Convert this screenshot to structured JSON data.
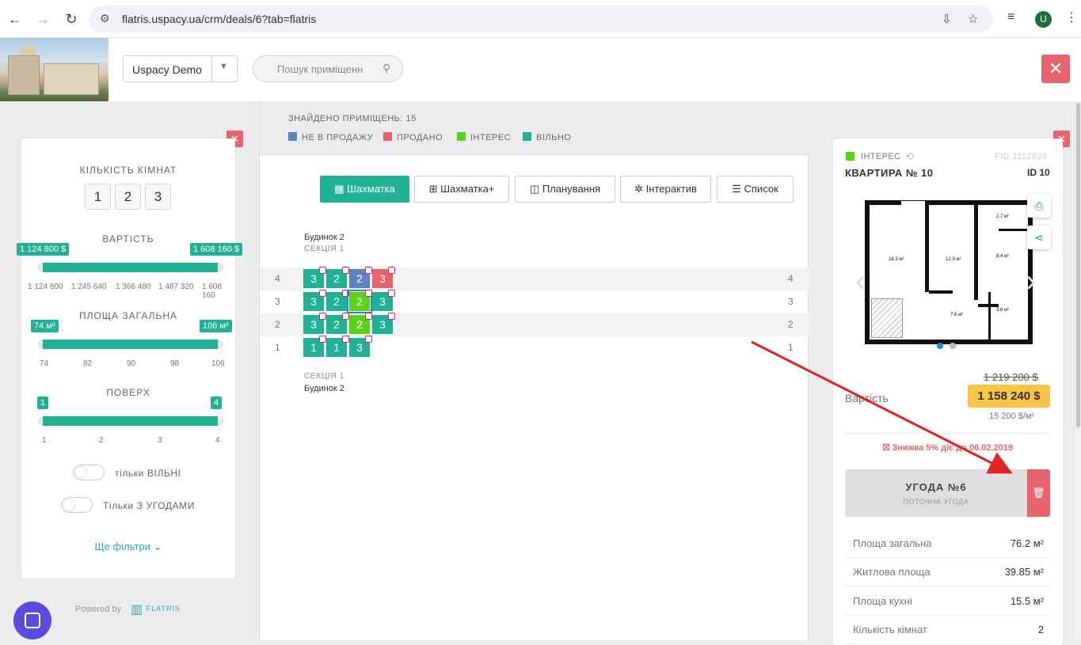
{
  "browser": {
    "url": "flatris.uspacy.ua/crm/deals/6?tab=flatris",
    "avatar_letter": "U"
  },
  "header": {
    "company_select": "Uspacy Demo",
    "search_placeholder": "Пошук приміщенн"
  },
  "filters": {
    "rooms_title": "КІЛЬКІСТЬ КІМНАТ",
    "rooms": [
      "1",
      "2",
      "3"
    ],
    "price_title": "ВАРТІСТЬ",
    "price_min_tag": "1 124 800 $",
    "price_max_tag": "1 608 160 $",
    "price_ticks": [
      "1 124 800",
      "1 245 640",
      "1 366 480",
      "1 487 320",
      "1 608 160"
    ],
    "area_title": "ПЛОЩА ЗАГАЛЬНА",
    "area_min_tag": "74 м²",
    "area_max_tag": "106 м²",
    "area_ticks": [
      "74",
      "82",
      "90",
      "98",
      "106"
    ],
    "floor_title": "ПОВЕРХ",
    "floor_min_tag": "1",
    "floor_max_tag": "4",
    "floor_ticks": [
      "1",
      "2",
      "3",
      "4"
    ],
    "toggle_free": "тільки ВІЛЬНІ",
    "toggle_deals": "Тільки З УГОДАМИ",
    "more_filters": "Ще фільтри",
    "powered_by": "Powered by",
    "brand": "FLATRIS"
  },
  "grid": {
    "found_label": "ЗНАЙДЕНО ПРИМІЩЕНЬ: 15",
    "legend": [
      {
        "label": "НЕ В ПРОДАЖУ",
        "color": "#5b84c0"
      },
      {
        "label": "ПРОДАНО",
        "color": "#e9636e"
      },
      {
        "label": "ІНТЕРЕС",
        "color": "#5ad21a"
      },
      {
        "label": "ВІЛЬНО",
        "color": "#21b295"
      }
    ],
    "views": [
      "Шахматка",
      "Шахматка+",
      "Планування",
      "Інтерактив",
      "Список"
    ],
    "building": "Будинок 2",
    "section": "СЕКЦІЯ 1",
    "floors": [
      {
        "floor": "4",
        "units": [
          {
            "rooms": "3",
            "status": "free",
            "gift": true
          },
          {
            "rooms": "2",
            "status": "free",
            "gift": true
          },
          {
            "rooms": "2",
            "status": "not",
            "gift": true
          },
          {
            "rooms": "3",
            "status": "sold",
            "gift": true
          }
        ]
      },
      {
        "floor": "3",
        "units": [
          {
            "rooms": "3",
            "status": "free",
            "gift": true
          },
          {
            "rooms": "2",
            "status": "free",
            "gift": true
          },
          {
            "rooms": "2",
            "status": "int",
            "gift": true,
            "selected": true
          },
          {
            "rooms": "3",
            "status": "free",
            "gift": true
          }
        ]
      },
      {
        "floor": "2",
        "units": [
          {
            "rooms": "3",
            "status": "free",
            "gift": true
          },
          {
            "rooms": "2",
            "status": "free",
            "gift": true
          },
          {
            "rooms": "2",
            "status": "int",
            "gift": true
          },
          {
            "rooms": "3",
            "status": "free",
            "gift": true
          }
        ]
      },
      {
        "floor": "1",
        "units": [
          {
            "rooms": "1",
            "status": "free",
            "gift": true
          },
          {
            "rooms": "1",
            "status": "free",
            "gift": true
          },
          {
            "rooms": "3",
            "status": "free",
            "gift": true
          }
        ]
      }
    ]
  },
  "unit": {
    "status": "ІНТЕРЕС",
    "fid": "FID 1112828",
    "title": "КВАРТИРА № 10",
    "id": "ID 10",
    "rooms_on_plan": [
      "2.7 м²",
      "18.3 м²",
      "12.9 м²",
      "8.4 м²",
      "7.6 м²",
      "3.8 м²"
    ],
    "old_price": "1 219 200 $",
    "price_label": "Вартість",
    "price": "1 158 240 $",
    "price_per_m": "15 200 $/м²",
    "discount": "Знижка 5% діє до 06.02.2019",
    "deal_title": "УГОДА №6",
    "deal_sub": "ПОТОЧНА УГОДА",
    "props": [
      {
        "label": "Площа загальна",
        "value": "76.2 м²"
      },
      {
        "label": "Житлова площа",
        "value": "39.85 м²"
      },
      {
        "label": "Площа кухні",
        "value": "15.5 м²"
      },
      {
        "label": "Кількість кімнат",
        "value": "2"
      }
    ]
  },
  "colors": {
    "accent": "#21b295",
    "danger": "#e9636e",
    "price": "#f7c445",
    "annotation_arrow": "#e02424"
  }
}
